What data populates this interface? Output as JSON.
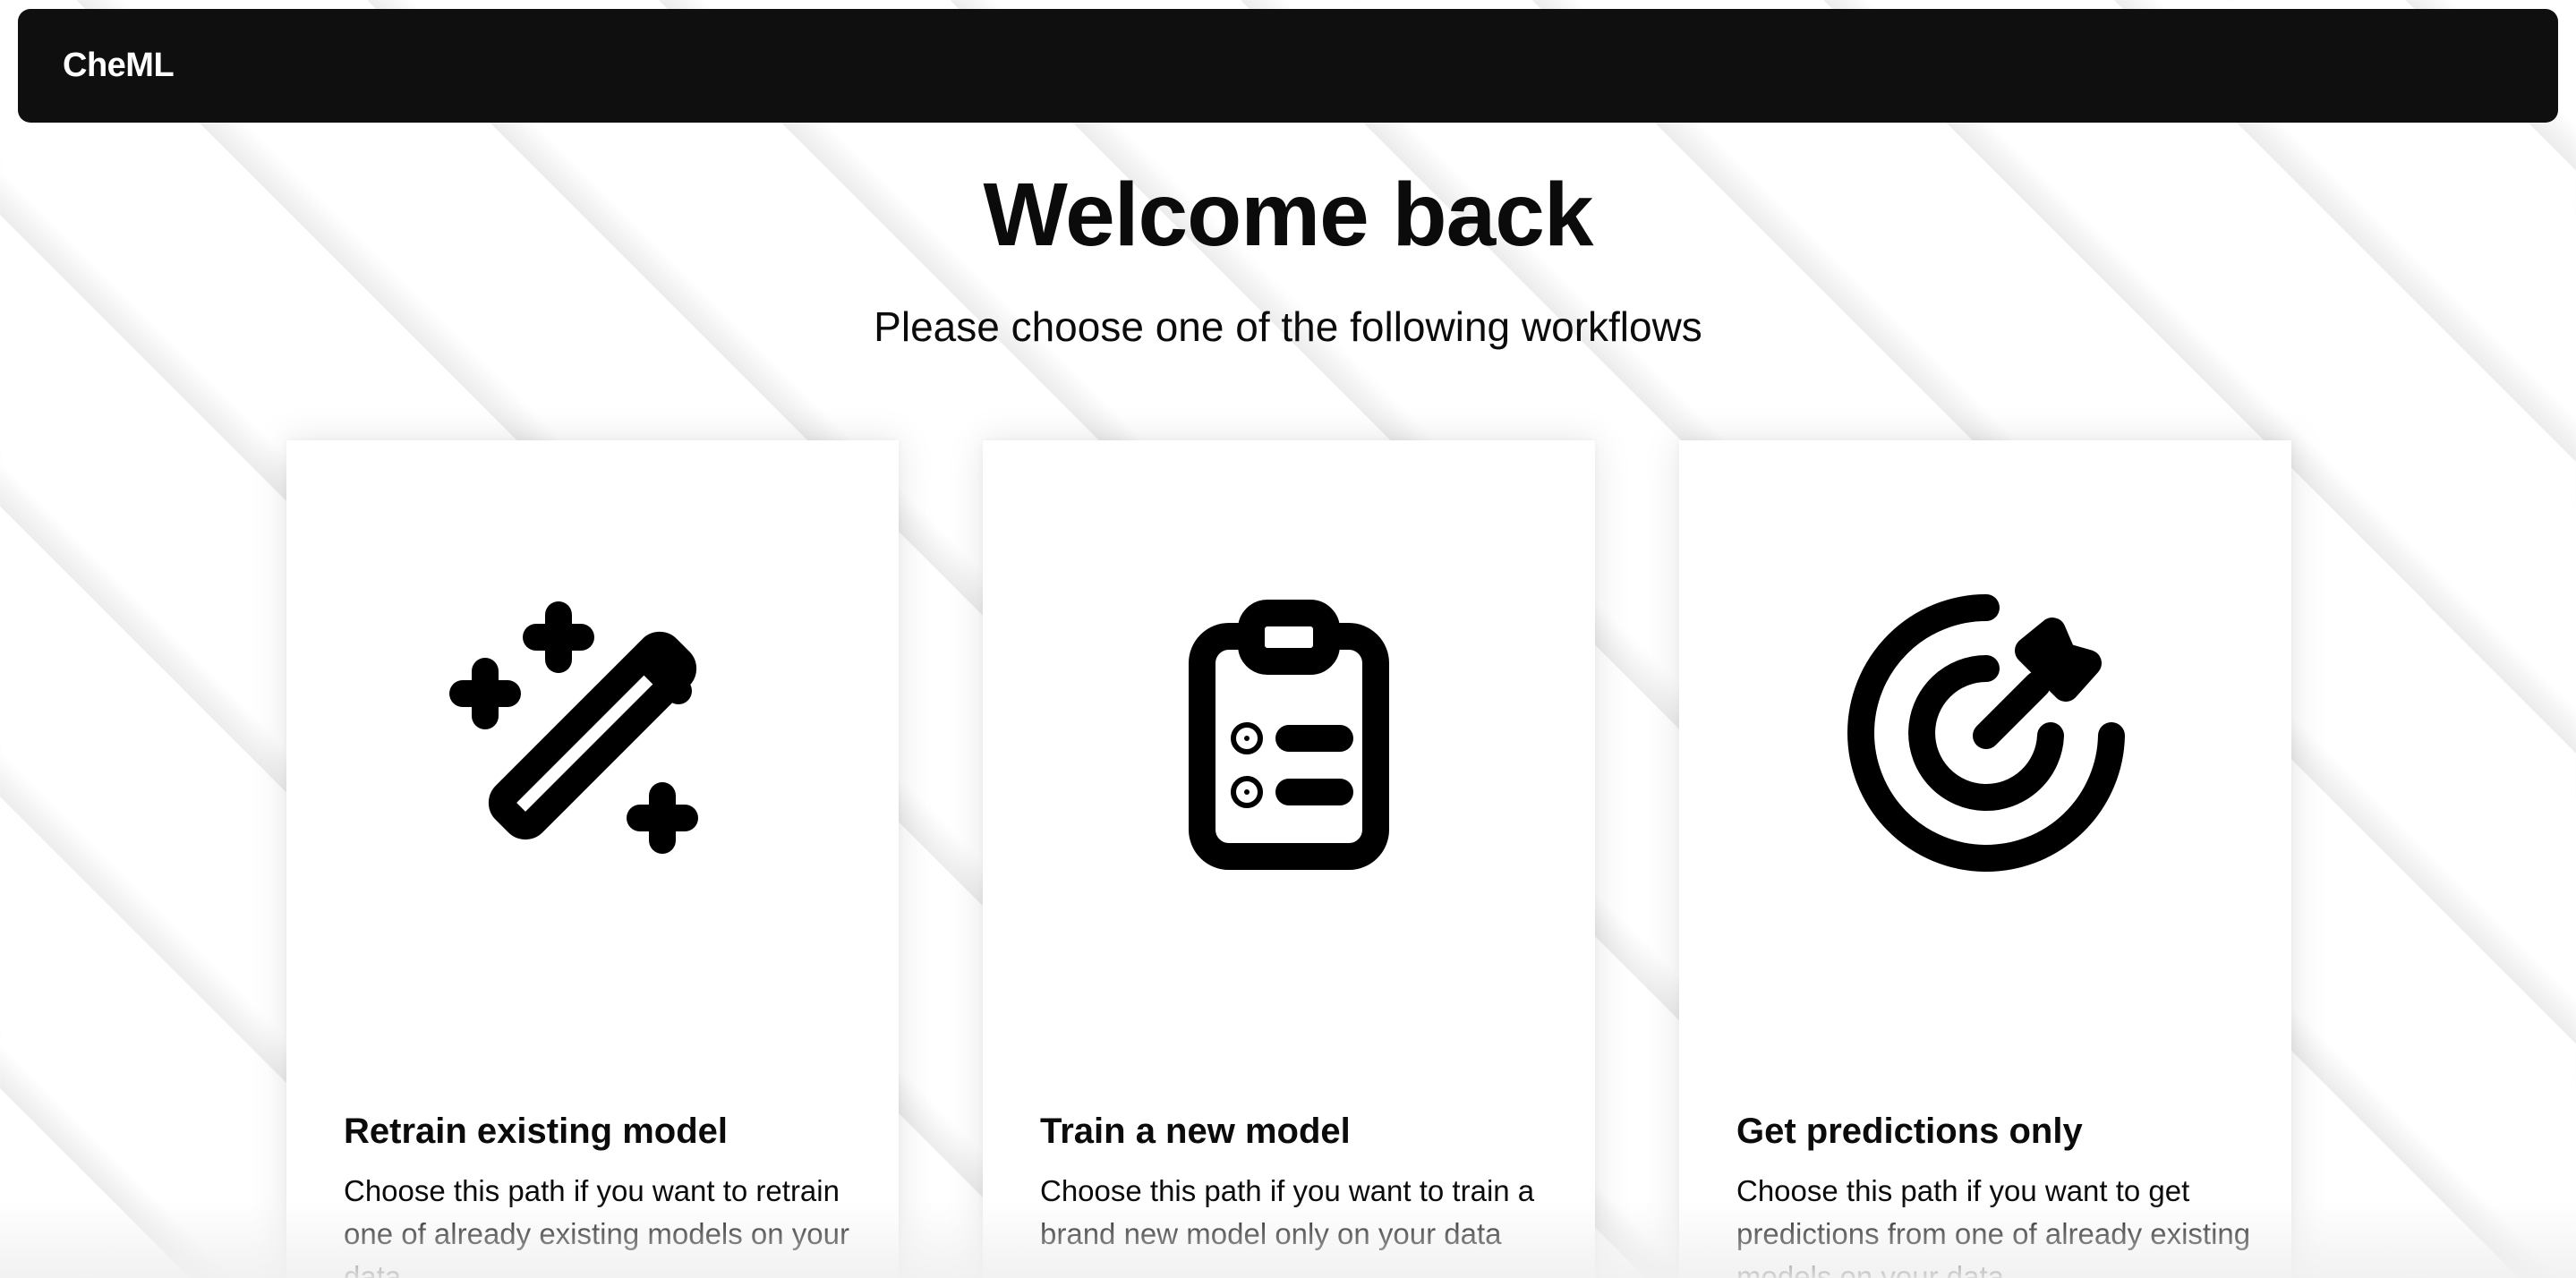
{
  "app": {
    "brand": "CheML"
  },
  "main": {
    "title": "Welcome back",
    "subtitle": "Please choose one of the following workflows"
  },
  "workflows": [
    {
      "title": "Retrain existing model",
      "description": "Choose this path if you want to retrain one of already existing models on your data",
      "icon": "magic-wand-icon"
    },
    {
      "title": "Train a new model",
      "description": "Choose this path if you want to train a brand new model only on your data",
      "icon": "clipboard-list-icon"
    },
    {
      "title": "Get predictions only",
      "description": "Choose this path if you want to get predictions from one of already existing models on your data",
      "icon": "target-arrow-icon"
    }
  ],
  "colors": {
    "navbar_bg": "#0f0f0f",
    "text": "#0b0b0b",
    "card_bg": "#ffffff"
  }
}
